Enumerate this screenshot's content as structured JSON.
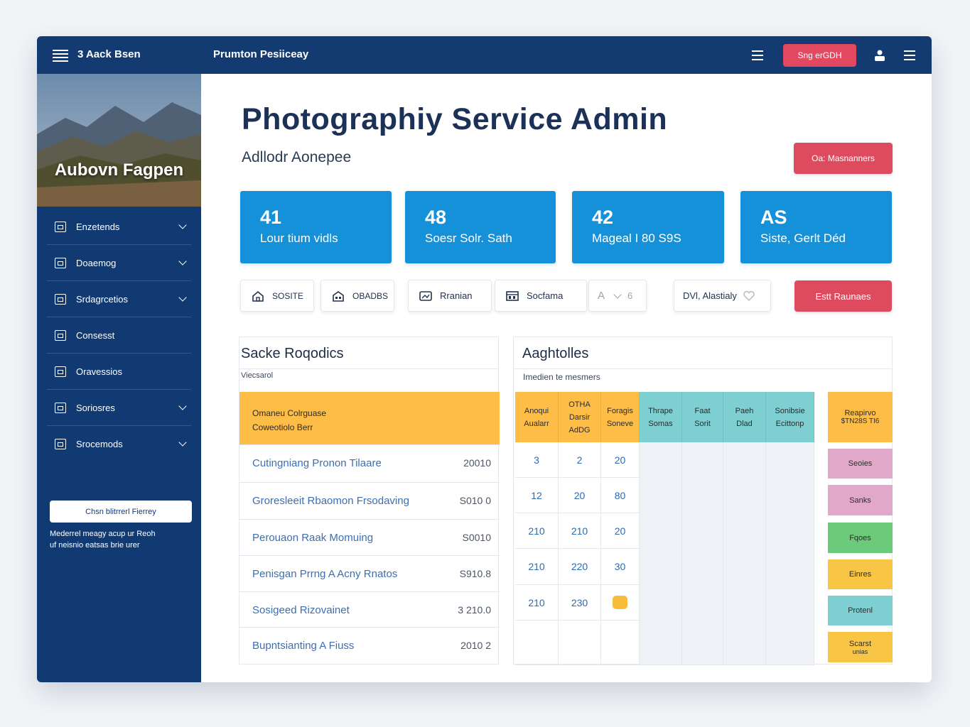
{
  "topbar": {
    "brand": "3 Aack Bsen",
    "page": "Prumton Pesiiceay",
    "button": "Sng erGDH"
  },
  "sidebar": {
    "hero_title": "Aubovn Fagpen",
    "items": [
      {
        "label": "Enzetends"
      },
      {
        "label": "Doaemog"
      },
      {
        "label": "Srdagrcetios"
      },
      {
        "label": "Consesst"
      },
      {
        "label": "Oravessios"
      },
      {
        "label": "Soriosres"
      },
      {
        "label": "Srocemods"
      }
    ],
    "button": "Chsn blitrrerl Fierrey",
    "note_line1": "Mederrel meagy acup ur Reoh",
    "note_line2": "uf neisnio eatsas brie urer"
  },
  "main": {
    "title": "Photographiy Service Admin",
    "subtitle": "Adllodr Aonepee",
    "manager_button": "Oa: Masnanners",
    "save_button": "Estt Raunaes",
    "stats": [
      {
        "value": "41",
        "label": "Lour tium vidls"
      },
      {
        "value": "48",
        "label": "Soesr Solr. Sath"
      },
      {
        "value": "42",
        "label": "Mageal I 80 S9S"
      },
      {
        "value": "AS",
        "label": "Siste, Gerlt Déd"
      }
    ],
    "chips": {
      "c1": "SOSITE",
      "c2": "OBADBS",
      "c3": "Rranian",
      "c4": "Socfama",
      "c5": "A",
      "c5b": "6",
      "c6": "DVl, Alastialy"
    }
  },
  "left_panel": {
    "title": "Sacke Roqodics",
    "subtitle": "Viecsarol",
    "header_line1": "Omaneu Colrguase",
    "header_line2": "Coweotiolo Berr",
    "rows": [
      {
        "name": "Cutingniang Pronon Tilaare",
        "amount": "20010"
      },
      {
        "name": "Groresleeit Rbaomon Frsodaving",
        "amount": "S010 0"
      },
      {
        "name": "Perouaon Raak Momuing",
        "amount": "S0010"
      },
      {
        "name": "Penisgan Prrng A Acny Rnatos",
        "amount": "S910.8"
      },
      {
        "name": "Sosigeed Rizovainet",
        "amount": "3 210.0"
      },
      {
        "name": "Bupntsianting A Fiuss",
        "amount": "2010 2"
      }
    ]
  },
  "right_panel": {
    "title": "Aaghtolles",
    "subtitle": "Imedien te mesmers",
    "headers": [
      {
        "l1": "Anoqui",
        "l2": "Aualarr"
      },
      {
        "l1": "OTHA",
        "l2": "Darsir",
        "l3": "AdDG"
      },
      {
        "l1": "Foragis",
        "l2": "Soneve"
      },
      {
        "l1": "Thrape",
        "l2": "Somas"
      },
      {
        "l1": "Faat",
        "l2": "Sorit"
      },
      {
        "l1": "Paeh",
        "l2": "Dlad"
      },
      {
        "l1": "Sonibsie",
        "l2": "Ecittonp"
      }
    ],
    "rows": [
      [
        "3",
        "2",
        "20"
      ],
      [
        "12",
        "20",
        "80"
      ],
      [
        "210",
        "210",
        "20"
      ],
      [
        "210",
        "220",
        "30"
      ],
      [
        "210",
        "230",
        ""
      ]
    ],
    "tags": [
      {
        "l1": "Reapirvo",
        "l2": "$TN28S TI6"
      },
      {
        "l1": "Seoies"
      },
      {
        "l1": "Sanks"
      },
      {
        "l1": "Fqoes"
      },
      {
        "l1": "Einres"
      },
      {
        "l1": "Protenl"
      },
      {
        "l1": "Scarst",
        "l2": "unias"
      }
    ]
  },
  "colors": {
    "primary_navy": "#143a72",
    "stat_blue": "#1591d9",
    "accent_red": "#de4b5e",
    "header_yellow": "#fdbd46",
    "teal": "#7ecfd1",
    "pink": "#e2a8c9",
    "green": "#6ccb7a"
  }
}
